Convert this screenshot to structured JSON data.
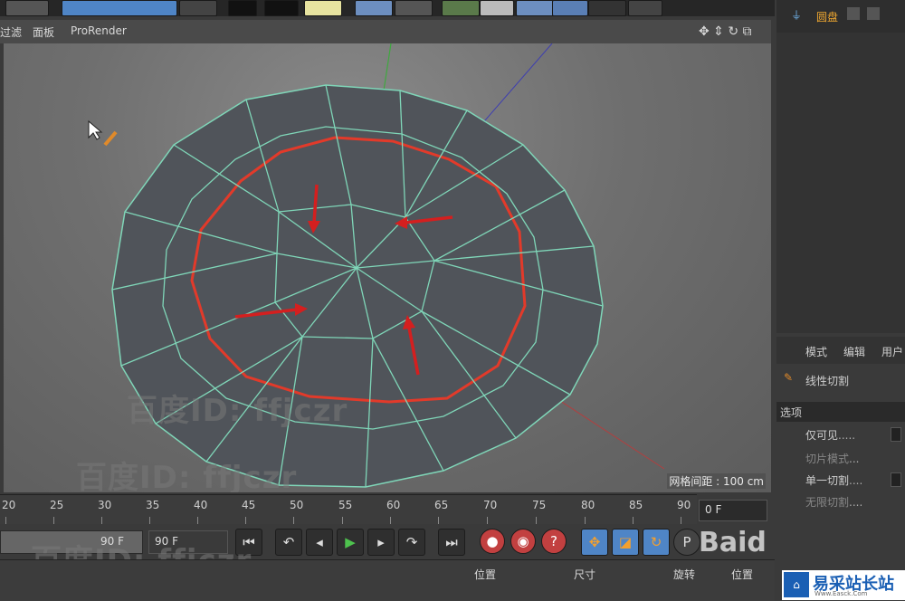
{
  "viewport_menu": {
    "filter": "过滤",
    "panel": "面板",
    "prorender": "ProRender"
  },
  "viewport": {
    "grid_spacing": "网格间距 : 100 cm"
  },
  "timeline": {
    "ticks": [
      "20",
      "25",
      "30",
      "35",
      "40",
      "45",
      "50",
      "55",
      "60",
      "65",
      "70",
      "75",
      "80",
      "85",
      "90"
    ],
    "current_frame": "0 F",
    "end_frame": "90 F",
    "end_frame2": "90 F"
  },
  "bottom_panel": {
    "position": "位置",
    "size": "尺寸",
    "rotation": "旋转",
    "position2": "位置"
  },
  "object_manager": {
    "object_name": "圆盘"
  },
  "attributes": {
    "menu_mode": "模式",
    "menu_edit": "编辑",
    "menu_user": "用户",
    "tool_name": "线性切割",
    "options_header": "选项",
    "visible_only": "仅可见",
    "slice_mode": "切片模式",
    "single_cut": "单一切割",
    "infinite_cut": "无限切割"
  },
  "watermarks": {
    "text": "百度ID: ffjczr",
    "baidu": "Baid"
  },
  "site_logo": {
    "name": "易采站长站",
    "url_text": "Www.Easck.Com"
  },
  "colors": {
    "mesh_edge": "#7fd6b8",
    "selected_loop": "#e23a2a",
    "arrow": "#d41f1f",
    "accent_blue": "#4f85c6"
  }
}
